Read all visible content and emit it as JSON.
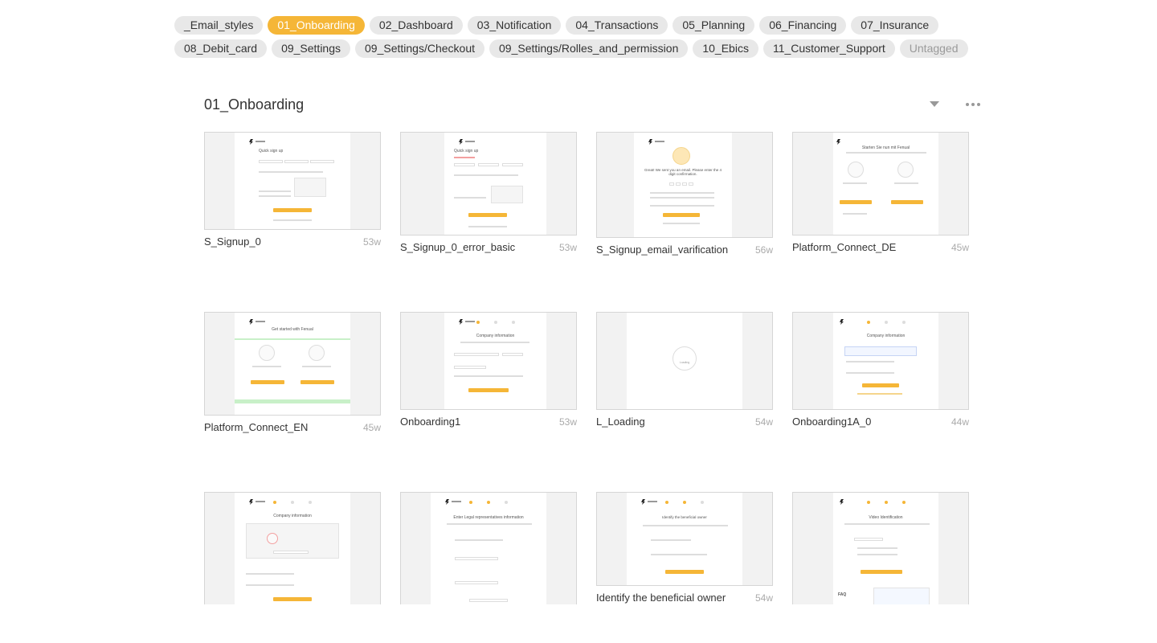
{
  "tags": {
    "row1": [
      "_Email_styles",
      "01_Onboarding",
      "02_Dashboard",
      "03_Notification",
      "04_Transactions",
      "05_Planning",
      "06_Financing",
      "07_Insurance"
    ],
    "row2": [
      "08_Debit_card",
      "09_Settings",
      "09_Settings/Checkout",
      "09_Settings/Rolles_and_permission",
      "10_Ebics",
      "11_Customer_Support",
      "Untagged"
    ],
    "active": "01_Onboarding",
    "muted": "Untagged"
  },
  "section": {
    "title": "01_Onboarding",
    "dropdown_icon": "chevron-down-icon",
    "more_icon": "more-icon"
  },
  "colors": {
    "accent": "#f5b637",
    "tag_bg": "#e8e8e8"
  },
  "artboards": [
    {
      "name": "S_Signup_0",
      "width": "53w",
      "thumb": {
        "title": "Quick sign up"
      }
    },
    {
      "name": "S_Signup_0_error_basic",
      "width": "53w",
      "thumb": {
        "title": "Quick sign up"
      }
    },
    {
      "name": "S_Signup_email_varification",
      "width": "56w",
      "thumb": {
        "title": "Great! We sent you an email. Please enter the 4 digit confirmation."
      }
    },
    {
      "name": "Platform_Connect_DE",
      "width": "45w",
      "thumb": {
        "title": "Starten Sie nun mit Fenual"
      }
    },
    {
      "name": "Platform_Connect_EN",
      "width": "45w",
      "thumb": {
        "title": "Get started with Fenual"
      }
    },
    {
      "name": "Onboarding1",
      "width": "53w",
      "thumb": {
        "title": "Company information"
      }
    },
    {
      "name": "L_Loading",
      "width": "54w",
      "thumb": {
        "title": "Loading"
      }
    },
    {
      "name": "Onboarding1A_0",
      "width": "44w",
      "thumb": {
        "title": "Company information"
      }
    },
    {
      "name": "",
      "width": "",
      "thumb": {
        "title": "Company information"
      }
    },
    {
      "name": "",
      "width": "",
      "thumb": {
        "title": "Enter Legal representatives information"
      }
    },
    {
      "name": "Identify the beneficial owner",
      "width": "54w",
      "thumb": {
        "title": "Identify the beneficial owner"
      }
    },
    {
      "name": "",
      "width": "",
      "thumb": {
        "title": "Video Identification",
        "faq": "FAQ"
      }
    }
  ]
}
